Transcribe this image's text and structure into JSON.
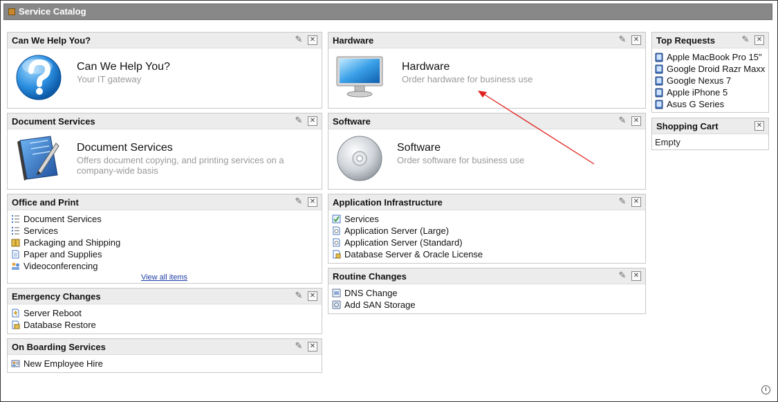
{
  "window": {
    "title": "Service Catalog"
  },
  "colors": {
    "link": "#1f3da6",
    "arrow": "#e0201c",
    "header_bg": "#888888",
    "panel_head_bg": "#ececec"
  },
  "icons": {
    "edit": "pencil-icon",
    "close": "close-icon",
    "footer": "clock-icon"
  },
  "panels": {
    "help": {
      "title": "Can We Help You?",
      "feature_title": "Can We Help You?",
      "feature_sub": "Your IT gateway"
    },
    "hardware": {
      "title": "Hardware",
      "feature_title": "Hardware",
      "feature_sub": "Order hardware for business use"
    },
    "docs": {
      "title": "Document Services",
      "feature_title": "Document Services",
      "feature_sub": "Offers document copying, and printing services on a company-wide basis"
    },
    "software": {
      "title": "Software",
      "feature_title": "Software",
      "feature_sub": "Order software for business use"
    },
    "office": {
      "title": "Office and Print",
      "items": [
        "Document Services",
        "Services",
        "Packaging and Shipping",
        "Paper and Supplies",
        "Videoconferencing"
      ],
      "view_all": "View all items"
    },
    "appinfra": {
      "title": "Application Infrastructure",
      "items": [
        "Services",
        "Application Server (Large)",
        "Application Server (Standard)",
        "Database Server & Oracle License"
      ]
    },
    "emergency": {
      "title": "Emergency Changes",
      "items": [
        "Server Reboot",
        "Database Restore"
      ]
    },
    "routine": {
      "title": "Routine Changes",
      "items": [
        "DNS Change",
        "Add SAN Storage"
      ]
    },
    "onboarding": {
      "title": "On Boarding Services",
      "items": [
        "New Employee Hire"
      ]
    },
    "top": {
      "title": "Top Requests",
      "items": [
        "Apple MacBook Pro 15\"",
        "Google Droid Razr Maxx",
        "Google Nexus 7",
        "Apple iPhone 5",
        "Asus G Series"
      ]
    },
    "cart": {
      "title": "Shopping Cart",
      "status": "Empty"
    }
  }
}
